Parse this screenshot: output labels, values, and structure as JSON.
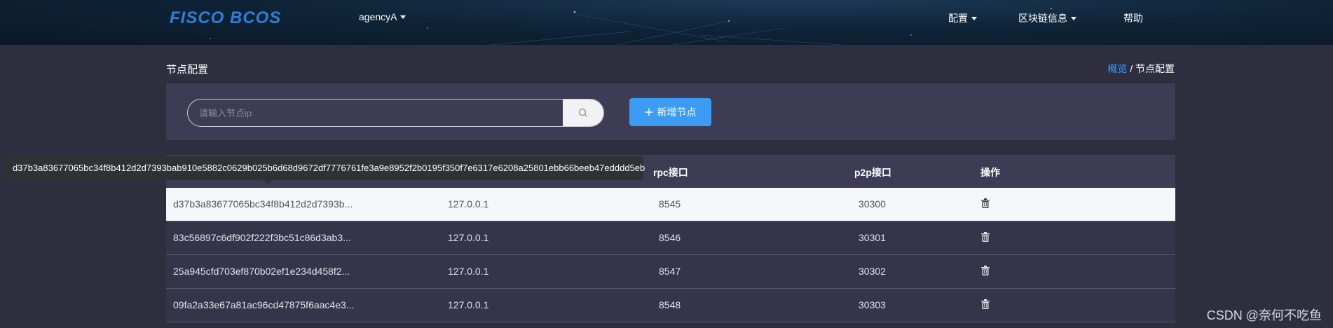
{
  "header": {
    "logo": "FISCO BCOS",
    "agency": "agencyA",
    "menu": {
      "config": "配置",
      "chain_info": "区块链信息",
      "help": "帮助"
    }
  },
  "page": {
    "title": "节点配置",
    "breadcrumb_link": "概览",
    "breadcrumb_sep": "/",
    "breadcrumb_current": "节点配置"
  },
  "toolbar": {
    "search_placeholder": "请输入节点ip",
    "add_label": "新增节点"
  },
  "table": {
    "headers": [
      "rpc接口",
      "p2p接口",
      "操作"
    ],
    "rows": [
      {
        "node_id": "d37b3a83677065bc34f8b412d2d7393b...",
        "ip": "127.0.0.1",
        "rpc": "8545",
        "p2p": "30300"
      },
      {
        "node_id": "83c56897c6df902f222f3bc51c86d3ab3...",
        "ip": "127.0.0.1",
        "rpc": "8546",
        "p2p": "30301"
      },
      {
        "node_id": "25a945cfd703ef870b02ef1e234d458f2...",
        "ip": "127.0.0.1",
        "rpc": "8547",
        "p2p": "30302"
      },
      {
        "node_id": "09fa2a33e67a81ac96cd47875f6aac4e3...",
        "ip": "127.0.0.1",
        "rpc": "8548",
        "p2p": "30303"
      }
    ]
  },
  "tooltip": {
    "text": "d37b3a83677065bc34f8b412d2d7393bab910e5882c0629b025b6d68d9672df7776761fe3a9e8952f2b0195f350f7e6317e6208a25801ebb66beeb47edddd5eb"
  },
  "watermark": "CSDN @奈何不吃鱼",
  "colors": {
    "accent": "#3c9bf3",
    "background": "#2e2e3f",
    "panel": "#3c3c55"
  }
}
